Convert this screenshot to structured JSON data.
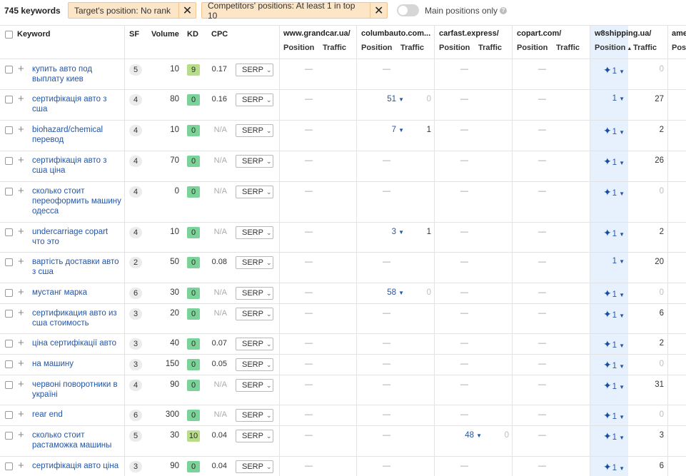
{
  "toolbar": {
    "keyword_count": "745 keywords",
    "filter1": "Target's position: No rank",
    "filter2": "Competitors' positions: At least 1 in top 10",
    "toggle_label": "Main positions only",
    "toggle_on": false
  },
  "columns": {
    "keyword": "Keyword",
    "sf": "SF",
    "volume": "Volume",
    "kd": "KD",
    "cpc": "CPC",
    "position": "Position",
    "traffic": "Traffic",
    "serp": "SERP"
  },
  "sites": [
    "www.grandcar.ua/",
    "columbauto.com...",
    "carfast.express/",
    "copart.com/",
    "w8shipping.ua/",
    "ame"
  ],
  "sub_partial": "Posi",
  "colors": {
    "kd_easy": "#7cd39a",
    "kd_light": "#a6e0b4",
    "kd_mid": "#b7dc8a",
    "highlight_column": "#e6f1fd",
    "link": "#2456a8",
    "chip_bg": "#fde6c8"
  },
  "rows": [
    {
      "keyword": "купить авто под выплату киев",
      "sf": "5",
      "volume": "10",
      "kd": "9",
      "cpc": "0.17",
      "grand": null,
      "columb": null,
      "carfast": null,
      "copart": null,
      "w8_pos": "1",
      "w8_star": true,
      "w8_traffic": "0"
    },
    {
      "keyword": "сертифікація авто з сша",
      "sf": "4",
      "volume": "80",
      "kd": "0",
      "cpc": "0.16",
      "grand": null,
      "columb": {
        "pos": "51",
        "traffic": "0"
      },
      "carfast": null,
      "copart": null,
      "w8_pos": "1",
      "w8_star": false,
      "w8_traffic": "27"
    },
    {
      "keyword": "biohazard/chemical перевод",
      "sf": "4",
      "volume": "10",
      "kd": "0",
      "cpc": "N/A",
      "grand": null,
      "columb": {
        "pos": "7",
        "traffic": "1"
      },
      "carfast": null,
      "copart": null,
      "w8_pos": "1",
      "w8_star": true,
      "w8_traffic": "2"
    },
    {
      "keyword": "сертифікація авто з сша ціна",
      "sf": "4",
      "volume": "70",
      "kd": "0",
      "cpc": "N/A",
      "grand": null,
      "columb": null,
      "carfast": null,
      "copart": null,
      "w8_pos": "1",
      "w8_star": true,
      "w8_traffic": "26"
    },
    {
      "keyword": "сколько стоит переоформить машину одесса",
      "sf": "4",
      "volume": "0",
      "kd": "0",
      "cpc": "N/A",
      "grand": null,
      "columb": null,
      "carfast": null,
      "copart": null,
      "w8_pos": "1",
      "w8_star": true,
      "w8_traffic": "0"
    },
    {
      "keyword": "undercarriage copart что это",
      "sf": "4",
      "volume": "10",
      "kd": "0",
      "cpc": "N/A",
      "grand": null,
      "columb": {
        "pos": "3",
        "traffic": "1"
      },
      "carfast": null,
      "copart": null,
      "w8_pos": "1",
      "w8_star": true,
      "w8_traffic": "2"
    },
    {
      "keyword": "вартість доставки авто з сша",
      "sf": "2",
      "volume": "50",
      "kd": "0",
      "cpc": "0.08",
      "grand": null,
      "columb": null,
      "carfast": null,
      "copart": null,
      "w8_pos": "1",
      "w8_star": false,
      "w8_traffic": "20"
    },
    {
      "keyword": "мустанг марка",
      "sf": "6",
      "volume": "30",
      "kd": "0",
      "cpc": "N/A",
      "grand": null,
      "columb": {
        "pos": "58",
        "traffic": "0"
      },
      "carfast": null,
      "copart": null,
      "w8_pos": "1",
      "w8_star": true,
      "w8_traffic": "0"
    },
    {
      "keyword": "сертификация авто из сша стоимость",
      "sf": "3",
      "volume": "20",
      "kd": "0",
      "cpc": "N/A",
      "grand": null,
      "columb": null,
      "carfast": null,
      "copart": null,
      "w8_pos": "1",
      "w8_star": true,
      "w8_traffic": "6"
    },
    {
      "keyword": "ціна сертифікації авто",
      "sf": "3",
      "volume": "40",
      "kd": "0",
      "cpc": "0.07",
      "grand": null,
      "columb": null,
      "carfast": null,
      "copart": null,
      "w8_pos": "1",
      "w8_star": true,
      "w8_traffic": "2"
    },
    {
      "keyword": "на машину",
      "sf": "3",
      "volume": "150",
      "kd": "0",
      "cpc": "0.05",
      "grand": null,
      "columb": null,
      "carfast": null,
      "copart": null,
      "w8_pos": "1",
      "w8_star": true,
      "w8_traffic": "0"
    },
    {
      "keyword": "червоні поворотники в україні",
      "sf": "4",
      "volume": "90",
      "kd": "0",
      "cpc": "N/A",
      "grand": null,
      "columb": null,
      "carfast": null,
      "copart": null,
      "w8_pos": "1",
      "w8_star": true,
      "w8_traffic": "31"
    },
    {
      "keyword": "rear end",
      "sf": "6",
      "volume": "300",
      "kd": "0",
      "cpc": "N/A",
      "grand": null,
      "columb": null,
      "carfast": null,
      "copart": null,
      "w8_pos": "1",
      "w8_star": true,
      "w8_traffic": "0"
    },
    {
      "keyword": "сколько стоит растаможка машины",
      "sf": "5",
      "volume": "30",
      "kd": "10",
      "cpc": "0.04",
      "grand": null,
      "columb": null,
      "carfast": {
        "pos": "48",
        "traffic": "0"
      },
      "copart": null,
      "w8_pos": "1",
      "w8_star": true,
      "w8_traffic": "3"
    },
    {
      "keyword": "сертифікація авто ціна",
      "sf": "3",
      "volume": "90",
      "kd": "0",
      "cpc": "0.04",
      "grand": null,
      "columb": null,
      "carfast": null,
      "copart": null,
      "w8_pos": "1",
      "w8_star": true,
      "w8_traffic": "6"
    }
  ]
}
